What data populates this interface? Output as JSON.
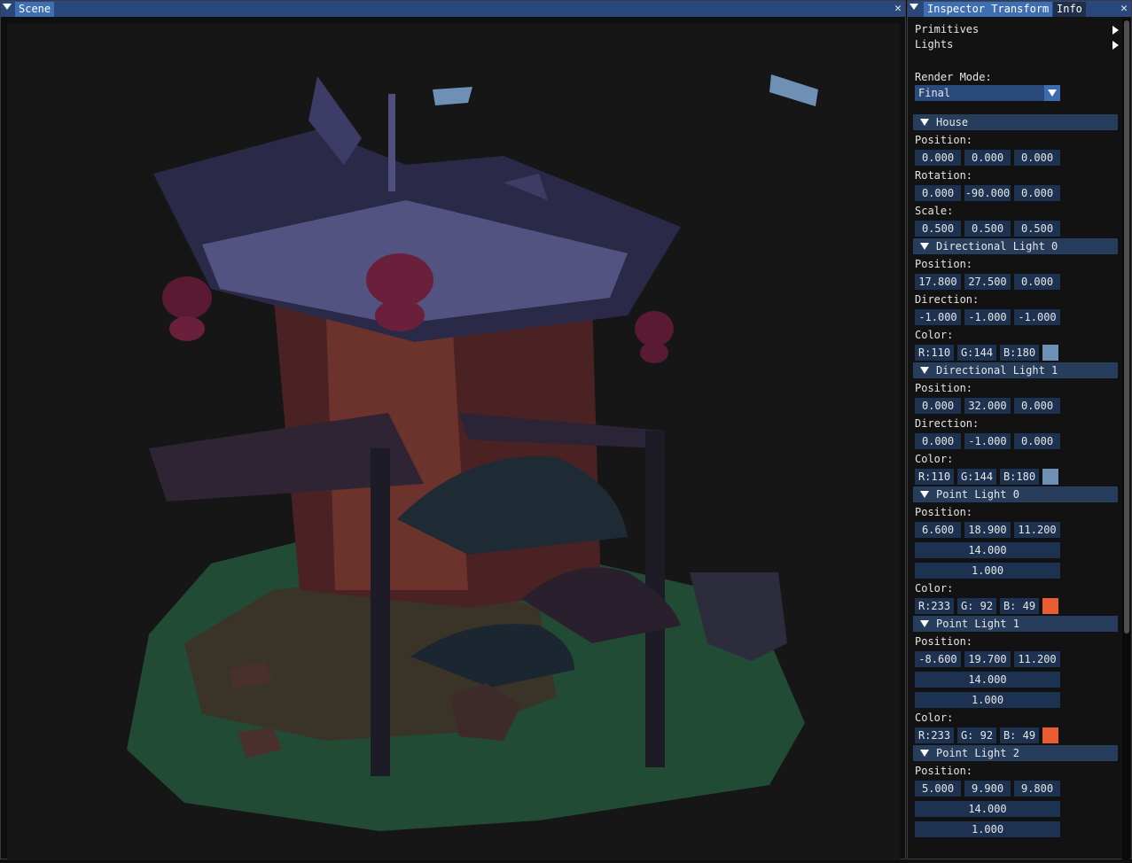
{
  "scene": {
    "title": "Scene"
  },
  "inspector": {
    "tabs": [
      "Inspector Transform",
      "Info"
    ],
    "menus": [
      "Primitives",
      "Lights"
    ],
    "render_mode": {
      "label": "Render Mode:",
      "value": "Final"
    },
    "sections": [
      {
        "title": "House",
        "rows": [
          {
            "label": "Position:",
            "values": [
              "0.000",
              "0.000",
              "0.000"
            ]
          },
          {
            "label": "Rotation:",
            "values": [
              "0.000",
              "-90.000",
              "0.000"
            ]
          },
          {
            "label": "Scale:",
            "values": [
              "0.500",
              "0.500",
              "0.500"
            ]
          }
        ]
      },
      {
        "title": "Directional Light 0",
        "rows": [
          {
            "label": "Position:",
            "values": [
              "17.800",
              "27.500",
              "0.000"
            ]
          },
          {
            "label": "Direction:",
            "values": [
              "-1.000",
              "-1.000",
              "-1.000"
            ]
          },
          {
            "label": "Color:",
            "values": [
              "R:110",
              "G:144",
              "B:180"
            ],
            "swatch": "#6e90b4"
          }
        ]
      },
      {
        "title": "Directional Light 1",
        "rows": [
          {
            "label": "Position:",
            "values": [
              "0.000",
              "32.000",
              "0.000"
            ]
          },
          {
            "label": "Direction:",
            "values": [
              "0.000",
              "-1.000",
              "0.000"
            ]
          },
          {
            "label": "Color:",
            "values": [
              "R:110",
              "G:144",
              "B:180"
            ],
            "swatch": "#6e90b4"
          }
        ]
      },
      {
        "title": "Point Light 0",
        "rows": [
          {
            "label": "Position:",
            "values": [
              "6.600",
              "18.900",
              "11.200"
            ],
            "extra": [
              "14.000",
              "1.000"
            ]
          },
          {
            "label": "Color:",
            "values": [
              "R:233",
              "G: 92",
              "B: 49"
            ],
            "swatch": "#e95c31"
          }
        ]
      },
      {
        "title": "Point Light 1",
        "rows": [
          {
            "label": "Position:",
            "values": [
              "-8.600",
              "19.700",
              "11.200"
            ],
            "extra": [
              "14.000",
              "1.000"
            ]
          },
          {
            "label": "Color:",
            "values": [
              "R:233",
              "G: 92",
              "B: 49"
            ],
            "swatch": "#e95c31"
          }
        ]
      },
      {
        "title": "Point Light 2",
        "rows": [
          {
            "label": "Position:",
            "values": [
              "5.000",
              "9.900",
              "9.800"
            ],
            "extra": [
              "14.000",
              "1.000"
            ]
          }
        ]
      }
    ]
  }
}
